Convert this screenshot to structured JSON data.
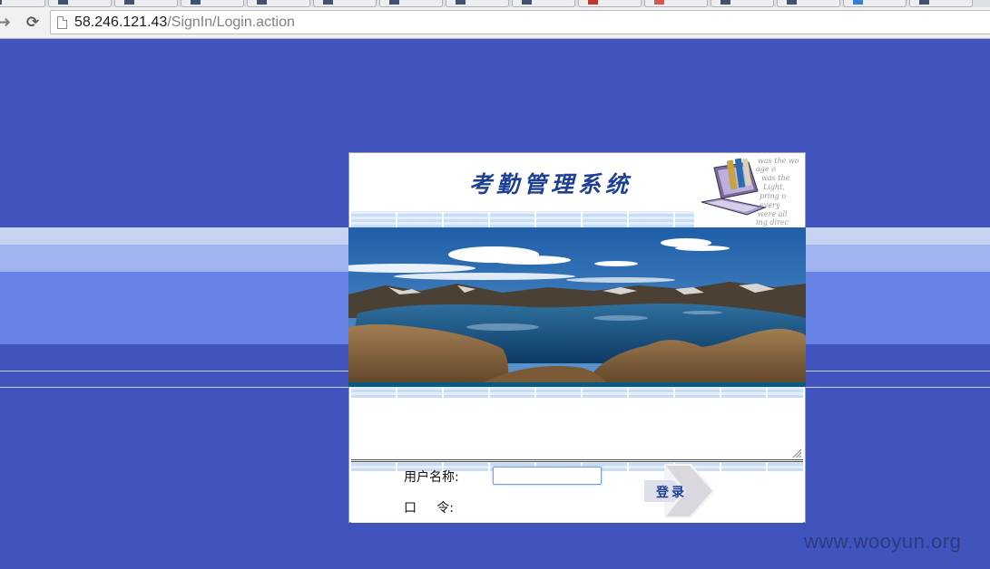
{
  "browser": {
    "url_host": "58.246.121.43",
    "url_path": "/SignIn/Login.action"
  },
  "app": {
    "title": "考勤管理系统"
  },
  "login_form": {
    "username_label": "用户名称:",
    "password_label": "口     令:",
    "username_value": "",
    "submit_label": "登录"
  },
  "watermark": "www.wooyun.org"
}
